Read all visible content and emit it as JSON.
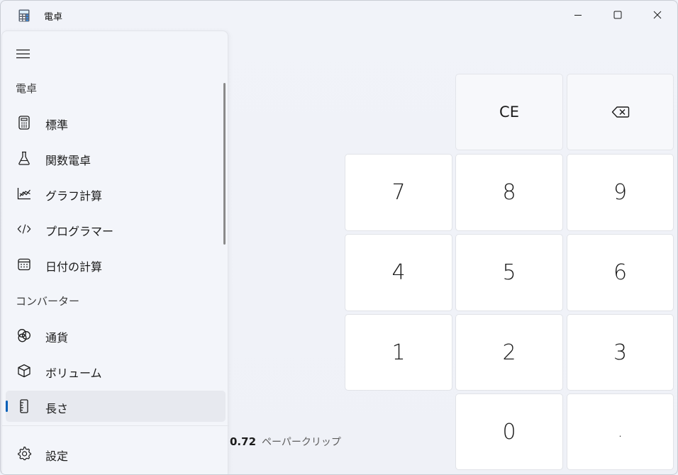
{
  "window": {
    "title": "電卓",
    "controls": {
      "minimize": "minimize-icon",
      "maximize": "maximize-icon",
      "close": "close-icon"
    }
  },
  "nav": {
    "menu_icon": "hamburger-icon",
    "section_calculator": "電卓",
    "calculator_items": [
      {
        "label": "標準",
        "icon": "calculator-icon"
      },
      {
        "label": "関数電卓",
        "icon": "flask-icon"
      },
      {
        "label": "グラフ計算",
        "icon": "graph-icon"
      },
      {
        "label": "プログラマー",
        "icon": "code-icon"
      },
      {
        "label": "日付の計算",
        "icon": "calendar-icon"
      }
    ],
    "section_converter": "コンバーター",
    "converter_items": [
      {
        "label": "通貨",
        "icon": "currency-icon"
      },
      {
        "label": "ボリューム",
        "icon": "cube-icon"
      },
      {
        "label": "長さ",
        "icon": "ruler-icon",
        "selected": true
      }
    ],
    "settings": {
      "label": "設定",
      "icon": "gear-icon"
    }
  },
  "keypad": {
    "ce": "CE",
    "backspace_icon": "backspace-icon",
    "digits": {
      "seven": "7",
      "eight": "8",
      "nine": "9",
      "four": "4",
      "five": "5",
      "six": "6",
      "one": "1",
      "two": "2",
      "three": "3",
      "zero": "0",
      "decimal": "."
    }
  },
  "result": {
    "value": "0.72",
    "unit": "ペーパークリップ"
  },
  "colors": {
    "accent": "#005fb8",
    "background": "#eef1f8",
    "key_background": "#ffffff"
  }
}
